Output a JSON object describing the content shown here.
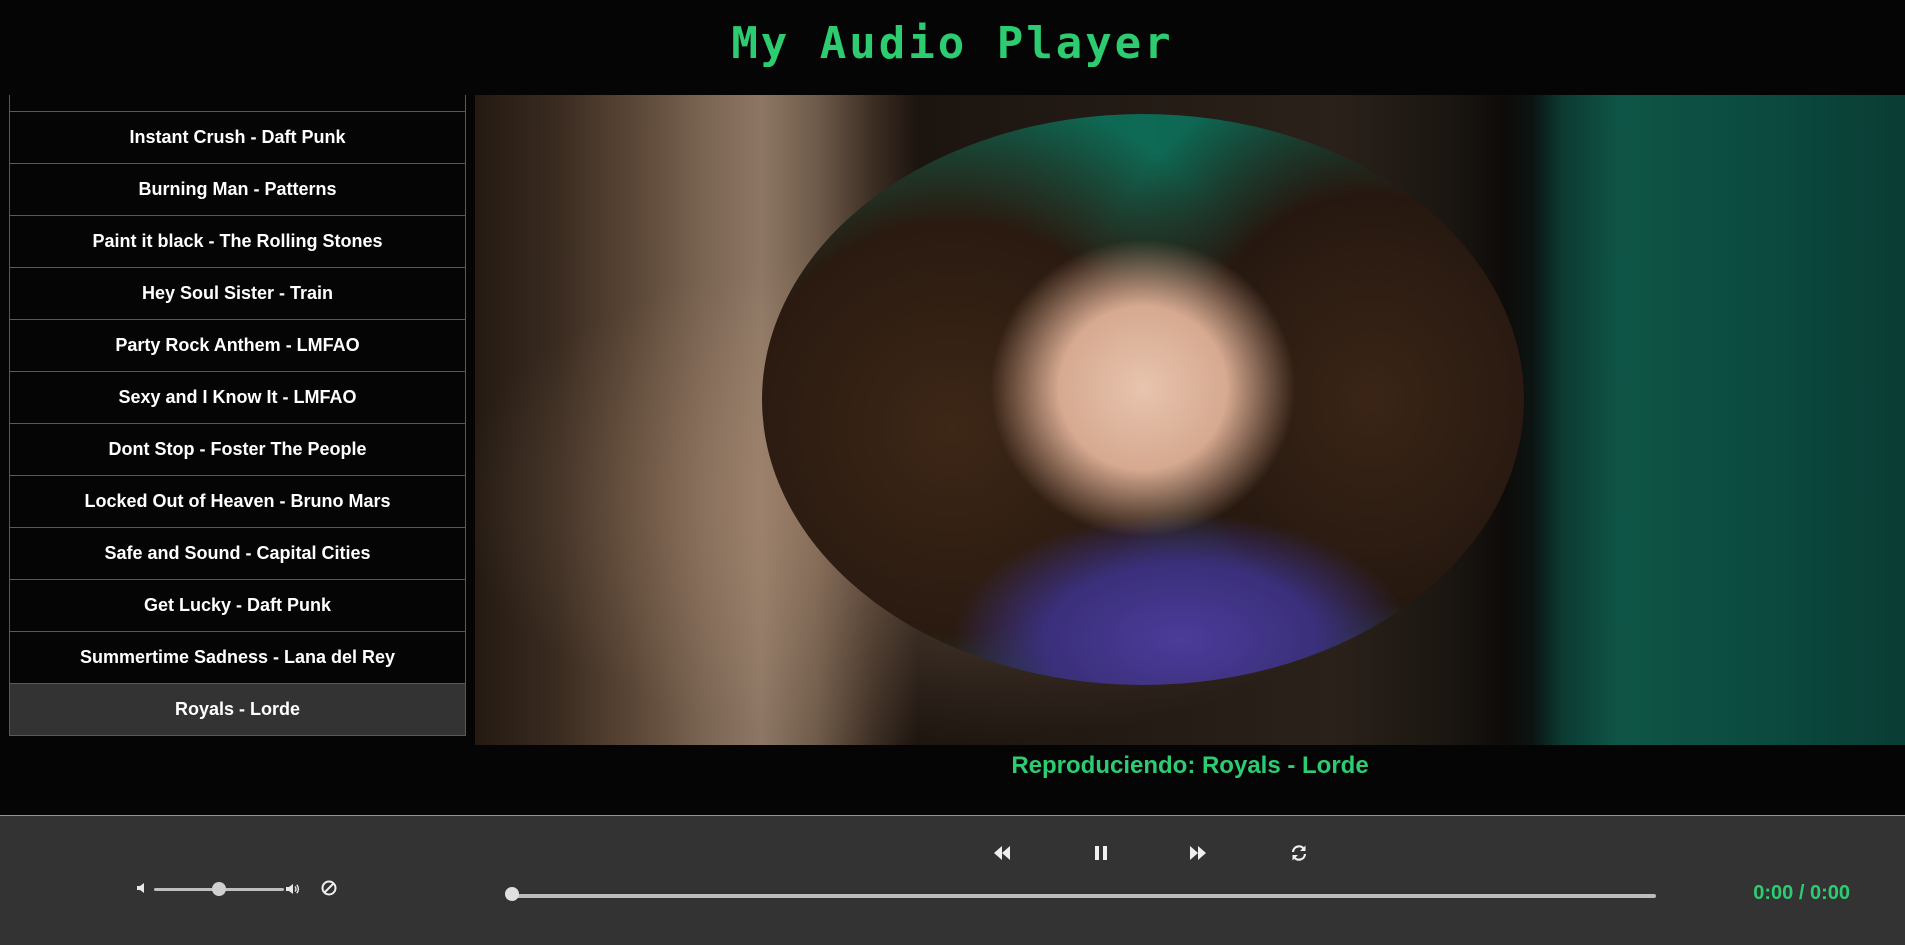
{
  "header": {
    "title": "My Audio Player"
  },
  "playlist": {
    "items": [
      {
        "label": "",
        "active": false
      },
      {
        "label": "Instant Crush - Daft Punk",
        "active": false
      },
      {
        "label": "Burning Man - Patterns",
        "active": false
      },
      {
        "label": "Paint it black - The Rolling Stones",
        "active": false
      },
      {
        "label": "Hey Soul Sister - Train",
        "active": false
      },
      {
        "label": "Party Rock Anthem - LMFAO",
        "active": false
      },
      {
        "label": "Sexy and I Know It - LMFAO",
        "active": false
      },
      {
        "label": "Dont Stop - Foster The People",
        "active": false
      },
      {
        "label": "Locked Out of Heaven - Bruno Mars",
        "active": false
      },
      {
        "label": "Safe and Sound - Capital Cities",
        "active": false
      },
      {
        "label": "Get Lucky - Daft Punk",
        "active": false
      },
      {
        "label": "Summertime Sadness - Lana del Rey",
        "active": false
      },
      {
        "label": "Royals - Lorde",
        "active": true
      }
    ]
  },
  "now_playing": {
    "text": "Reproduciendo: Royals - Lorde"
  },
  "controls": {
    "volume_level": 0.5,
    "seek_progress": 0.0,
    "time_display": "0:00 / 0:00",
    "icons": {
      "previous": "rewind-icon",
      "play_pause": "pause-icon",
      "next": "fast-forward-icon",
      "repeat": "repeat-icon",
      "volume_low": "volume-low-icon",
      "volume_high": "volume-high-icon",
      "mute": "mute-icon"
    }
  },
  "colors": {
    "accent": "#2ecc71",
    "background": "#050505",
    "control_bar": "#333333",
    "active_track": "#333333"
  }
}
